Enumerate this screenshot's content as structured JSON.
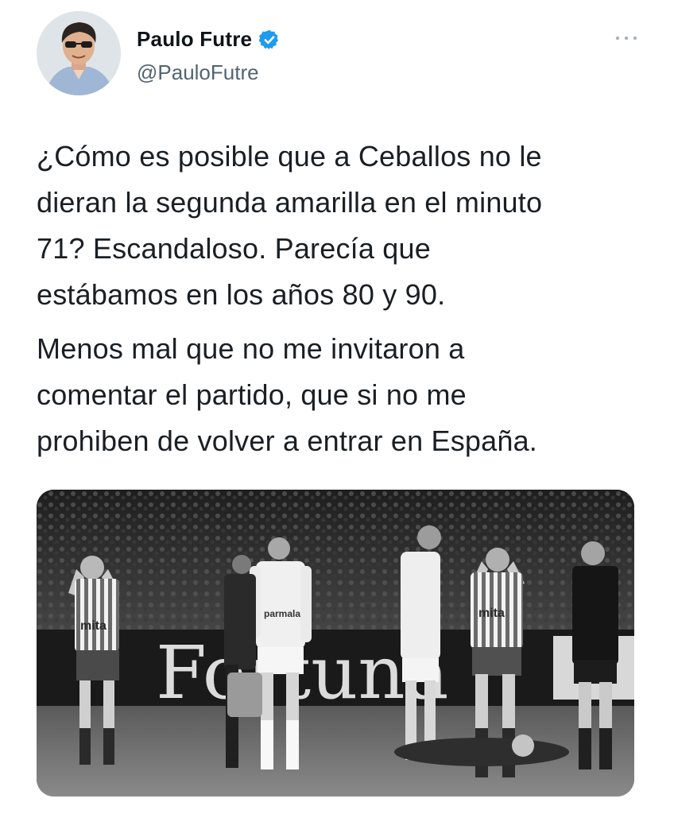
{
  "author": {
    "display_name": "Paulo Futre",
    "handle": "@PauloFutre",
    "verified": true,
    "avatar_icon": "profile-photo",
    "verified_icon": "verified-badge-icon",
    "more_icon": "more-dots-icon"
  },
  "tweet": {
    "paragraphs": [
      "¿Cómo es posible que a Ceballos no le\ndieran la segunda amarilla en el minuto\n71? Escandaloso. Parecía que\nestábamos en los años 80 y 90.",
      "Menos mal que no me invitaron a\ncomentar el partido, que si no me\nprohiben de volver a entrar en España."
    ]
  },
  "media": {
    "type": "photo",
    "style": "black-and-white",
    "board_text": "Fortuna",
    "shirt_text_striped": "mita",
    "shirt_text_white": "parmalat"
  },
  "colors": {
    "text": "#0f1419",
    "secondary": "#536471",
    "verified": "#1d9bf0"
  }
}
